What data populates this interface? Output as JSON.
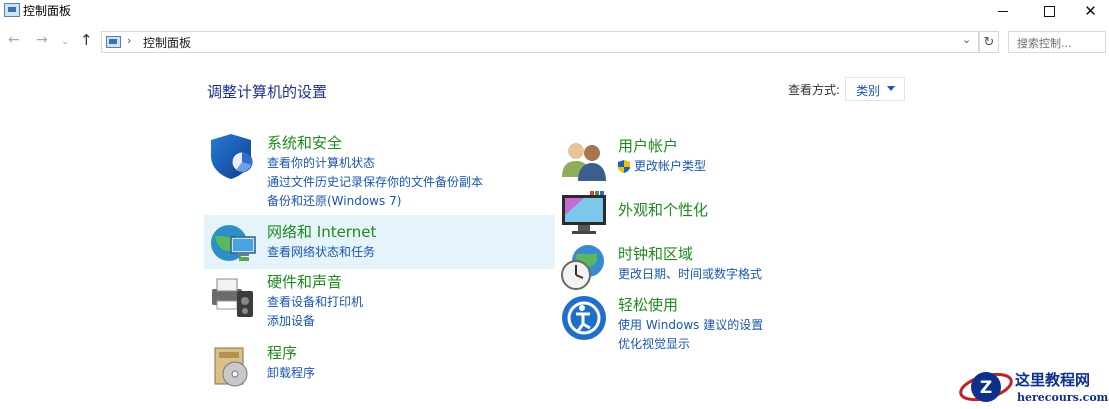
{
  "window": {
    "title": "控制面板",
    "controls": {
      "minimize": "minimize",
      "maximize": "maximize",
      "close": "✕"
    }
  },
  "nav": {
    "back_icon": "back-arrow-icon",
    "forward_icon": "forward-arrow-icon",
    "up_icon": "up-arrow-icon",
    "breadcrumb": [
      "控制面板"
    ],
    "search_placeholder": "搜索控制..."
  },
  "header": {
    "title": "调整计算机的设置",
    "view_by_label": "查看方式:",
    "view_by_value": "类别"
  },
  "left_categories": [
    {
      "icon": "shield-icon",
      "title": "系统和安全",
      "links": [
        "查看你的计算机状态",
        "通过文件历史记录保存你的文件备份副本",
        "备份和还原(Windows 7)"
      ]
    },
    {
      "icon": "network-globe-icon",
      "title": "网络和 Internet",
      "links": [
        "查看网络状态和任务"
      ],
      "highlighted": true
    },
    {
      "icon": "printer-speaker-icon",
      "title": "硬件和声音",
      "links": [
        "查看设备和打印机",
        "添加设备"
      ]
    },
    {
      "icon": "programs-disc-icon",
      "title": "程序",
      "links": [
        "卸载程序"
      ]
    }
  ],
  "right_categories": [
    {
      "icon": "user-accounts-icon",
      "title": "用户帐户",
      "links": [
        "更改帐户类型"
      ],
      "link_icon": "uac-shield-icon"
    },
    {
      "icon": "appearance-monitor-icon",
      "title": "外观和个性化",
      "links": []
    },
    {
      "icon": "clock-globe-icon",
      "title": "时钟和区域",
      "links": [
        "更改日期、时间或数字格式"
      ]
    },
    {
      "icon": "ease-of-access-icon",
      "title": "轻松使用",
      "links": [
        "使用 Windows 建议的设置",
        "优化视觉显示"
      ]
    }
  ],
  "watermark": {
    "main": "这里教程网",
    "sub": "herecours.com",
    "logo_letter": "Z"
  },
  "colors": {
    "category_title": "#1f8a1f",
    "link": "#1a55b0",
    "page_title": "#1e3287",
    "hover_bg": "#e5f3fb"
  }
}
